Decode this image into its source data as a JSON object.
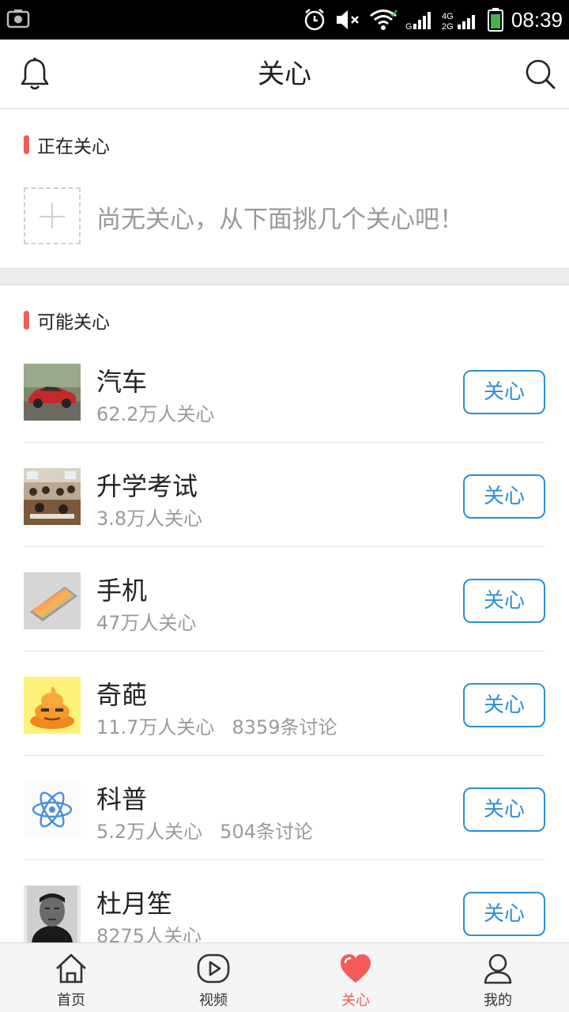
{
  "status_bar": {
    "time": "08:39",
    "network_labels": [
      "G",
      "4G",
      "2G"
    ]
  },
  "header": {
    "title": "关心",
    "left_icon": "bell-icon",
    "right_icon": "search-icon"
  },
  "following_section": {
    "title": "正在关心",
    "empty_message": "尚无关心，从下面挑几个关心吧！"
  },
  "suggest_section": {
    "title": "可能关心",
    "items": [
      {
        "name": "汽车",
        "followers": "62.2万人关心",
        "discussions": "",
        "button": "关心",
        "thumb": "car"
      },
      {
        "name": "升学考试",
        "followers": "3.8万人关心",
        "discussions": "",
        "button": "关心",
        "thumb": "classroom"
      },
      {
        "name": "手机",
        "followers": "47万人关心",
        "discussions": "",
        "button": "关心",
        "thumb": "phone"
      },
      {
        "name": "奇葩",
        "followers": "11.7万人关心",
        "discussions": "8359条讨论",
        "button": "关心",
        "thumb": "poop"
      },
      {
        "name": "科普",
        "followers": "5.2万人关心",
        "discussions": "504条讨论",
        "button": "关心",
        "thumb": "atom"
      },
      {
        "name": "杜月笙",
        "followers": "8275人关心",
        "discussions": "",
        "button": "关心",
        "thumb": "portrait"
      }
    ]
  },
  "bottom_nav": {
    "active_color": "#f45a5a",
    "items": [
      {
        "label": "首页",
        "icon": "home-icon"
      },
      {
        "label": "视频",
        "icon": "video-icon"
      },
      {
        "label": "关心",
        "icon": "heart-icon",
        "active": true
      },
      {
        "label": "我的",
        "icon": "user-icon"
      }
    ]
  },
  "colors": {
    "accent_blue": "#2b8fd6",
    "accent_red": "#f45a5a"
  }
}
